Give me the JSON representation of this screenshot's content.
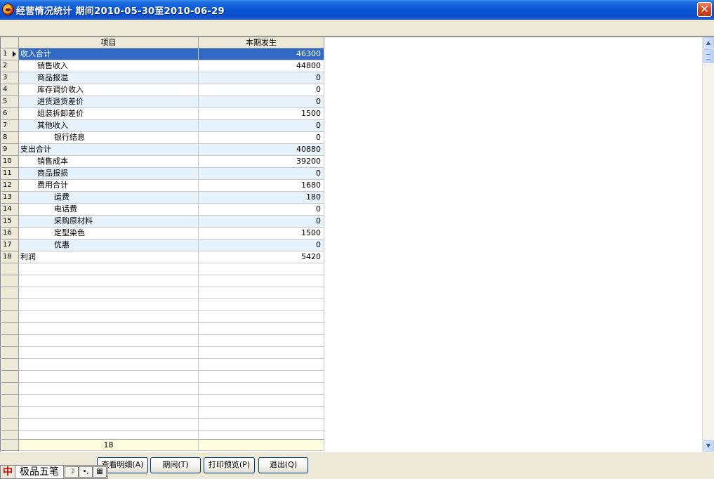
{
  "window": {
    "title": "经营情况统计  期间2010-05-30至2010-06-29",
    "close_glyph": "✕"
  },
  "grid": {
    "columns": [
      "项目",
      "本期发生"
    ],
    "rows": [
      {
        "num": "1",
        "name": "收入合计",
        "value": "46300",
        "indent": 0
      },
      {
        "num": "2",
        "name": "销售收入",
        "value": "44800",
        "indent": 1
      },
      {
        "num": "3",
        "name": "商品报溢",
        "value": "0",
        "indent": 1
      },
      {
        "num": "4",
        "name": "库存调价收入",
        "value": "0",
        "indent": 1
      },
      {
        "num": "5",
        "name": "进货退货差价",
        "value": "0",
        "indent": 1
      },
      {
        "num": "6",
        "name": "组装拆卸差价",
        "value": "1500",
        "indent": 1
      },
      {
        "num": "7",
        "name": "其他收入",
        "value": "0",
        "indent": 1
      },
      {
        "num": "8",
        "name": "银行结息",
        "value": "0",
        "indent": 2
      },
      {
        "num": "9",
        "name": "支出合计",
        "value": "40880",
        "indent": 0
      },
      {
        "num": "10",
        "name": "销售成本",
        "value": "39200",
        "indent": 1
      },
      {
        "num": "11",
        "name": "商品报损",
        "value": "0",
        "indent": 1
      },
      {
        "num": "12",
        "name": "费用合计",
        "value": "1680",
        "indent": 1
      },
      {
        "num": "13",
        "name": "运费",
        "value": "180",
        "indent": 2
      },
      {
        "num": "14",
        "name": "电话费",
        "value": "0",
        "indent": 2
      },
      {
        "num": "15",
        "name": "采购原材料",
        "value": "0",
        "indent": 2
      },
      {
        "num": "16",
        "name": "定型染色",
        "value": "1500",
        "indent": 2
      },
      {
        "num": "17",
        "name": "优惠",
        "value": "0",
        "indent": 2
      },
      {
        "num": "18",
        "name": "利润",
        "value": "5420",
        "indent": 0
      }
    ],
    "footer_count": "18"
  },
  "buttons": {
    "detail": "查看明细(A)",
    "period": "期间(T)",
    "preview": "打印预览(P)",
    "exit": "退出(Q)"
  },
  "ime": {
    "mode": "中",
    "name": "极品五笔",
    "moon": "☽",
    "punct": "•,",
    "keyboard": "▦"
  },
  "scrollbar": {
    "up": "▲",
    "down": "▼"
  }
}
